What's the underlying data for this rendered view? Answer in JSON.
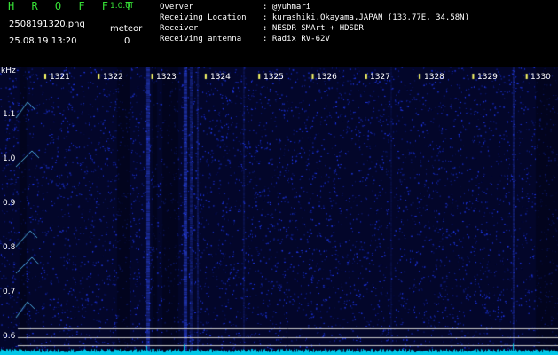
{
  "header": {
    "logo": "H R O F F T",
    "version": "1.0.0f",
    "filename": "2508191320.png",
    "timestamp": "25.08.19 13:20",
    "meteor_label": "meteor",
    "meteor_count": "0",
    "info_rows": [
      {
        "key": "Overver",
        "value": ": @yuhmari"
      },
      {
        "key": "Receiving Location",
        "value": ": kurashiki,Okayama,JAPAN (133.77E, 34.58N)"
      },
      {
        "key": "Receiver",
        "value": ": NESDR SMArt + HDSDR"
      },
      {
        "key": "Receiving antenna",
        "value": ": Radix RV-62V"
      }
    ]
  },
  "plot": {
    "unit": "kHz",
    "y_ticks": [
      "1.1",
      "1.0",
      "0.9",
      "0.8",
      "0.7",
      "0.6"
    ],
    "x_ticks": [
      "1321",
      "1322",
      "1323",
      "1324",
      "1325",
      "1326",
      "1327",
      "1328",
      "1329",
      "1330"
    ],
    "colors": {
      "background": "#03062a",
      "noise": "#2233ff",
      "trace": "#00e0ff",
      "grid": "#c8c8c8"
    }
  }
}
